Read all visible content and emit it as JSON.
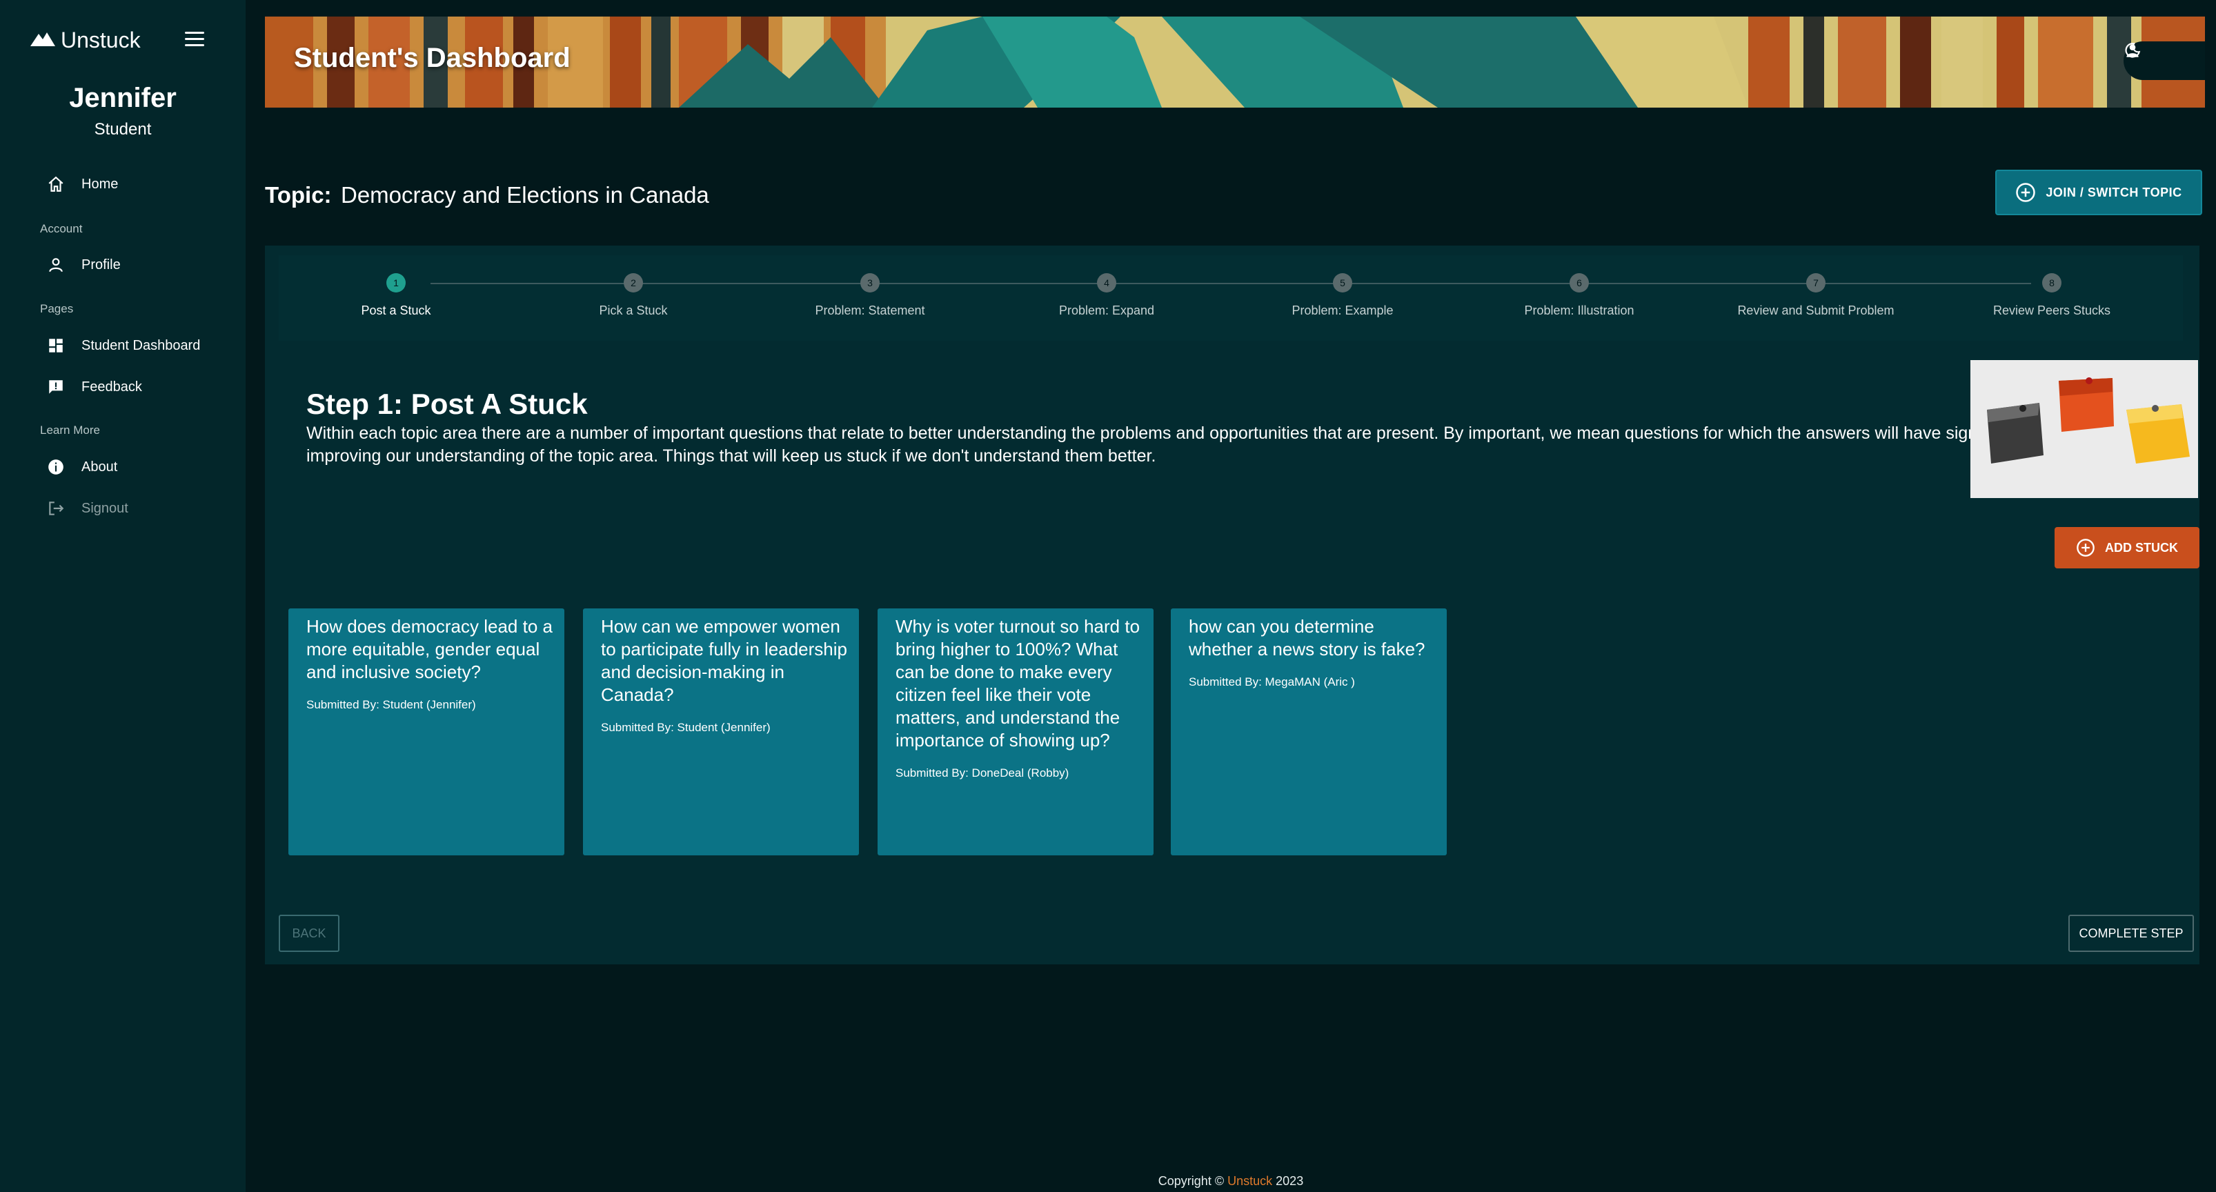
{
  "app": {
    "brand": "Unstuck"
  },
  "user": {
    "name": "Jennifer",
    "role": "Student"
  },
  "sidebar": {
    "home": "Home",
    "section_account": "Account",
    "profile": "Profile",
    "section_pages": "Pages",
    "student_dashboard": "Student Dashboard",
    "feedback": "Feedback",
    "section_learn": "Learn More",
    "about": "About",
    "signout": "Signout"
  },
  "header": {
    "title": "Student's Dashboard"
  },
  "topic": {
    "label": "Topic:",
    "value": "Democracy and Elections in Canada",
    "join_button": "JOIN / SWITCH TOPIC"
  },
  "steps": [
    {
      "num": "1",
      "label": "Post a Stuck",
      "active": true
    },
    {
      "num": "2",
      "label": "Pick a Stuck"
    },
    {
      "num": "3",
      "label": "Problem: Statement"
    },
    {
      "num": "4",
      "label": "Problem: Expand"
    },
    {
      "num": "5",
      "label": "Problem: Example"
    },
    {
      "num": "6",
      "label": "Problem: Illustration"
    },
    {
      "num": "7",
      "label": "Review and Submit Problem"
    },
    {
      "num": "8",
      "label": "Review Peers Stucks"
    }
  ],
  "step_content": {
    "title": "Step 1: Post A Stuck",
    "description": "Within each topic area there are a number of important questions that relate to better understanding the problems and opportunities that are present. By important, we mean questions for which the answers will have significant impact on improving our understanding of the topic area. Things that will keep us stuck if we don't understand them better.",
    "add_button": "ADD STUCK"
  },
  "stucks": [
    {
      "question": "How does democracy lead to a more equitable, gender equal and inclusive society?",
      "submitted": "Submitted By: Student (Jennifer)"
    },
    {
      "question": "How can we empower women to participate fully in leadership and decision-making in Canada?",
      "submitted": "Submitted By: Student (Jennifer)"
    },
    {
      "question": "Why is voter turnout so hard to bring higher to 100%? What can be done to make every citizen feel like their vote matters, and understand the importance of showing up?",
      "submitted": "Submitted By: DoneDeal (Robby)"
    },
    {
      "question": "how can you determine whether a news story is fake?",
      "submitted": "Submitted By: MegaMAN (Aric )"
    }
  ],
  "buttons": {
    "back": "BACK",
    "complete": "COMPLETE STEP"
  },
  "footer": {
    "prefix": "Copyright ©",
    "brand": "Unstuck",
    "year": "2023"
  },
  "colors": {
    "accent": "#1fa08f",
    "primary": "#0a6e7e",
    "add": "#c94f1d",
    "card": "#0b7386"
  }
}
